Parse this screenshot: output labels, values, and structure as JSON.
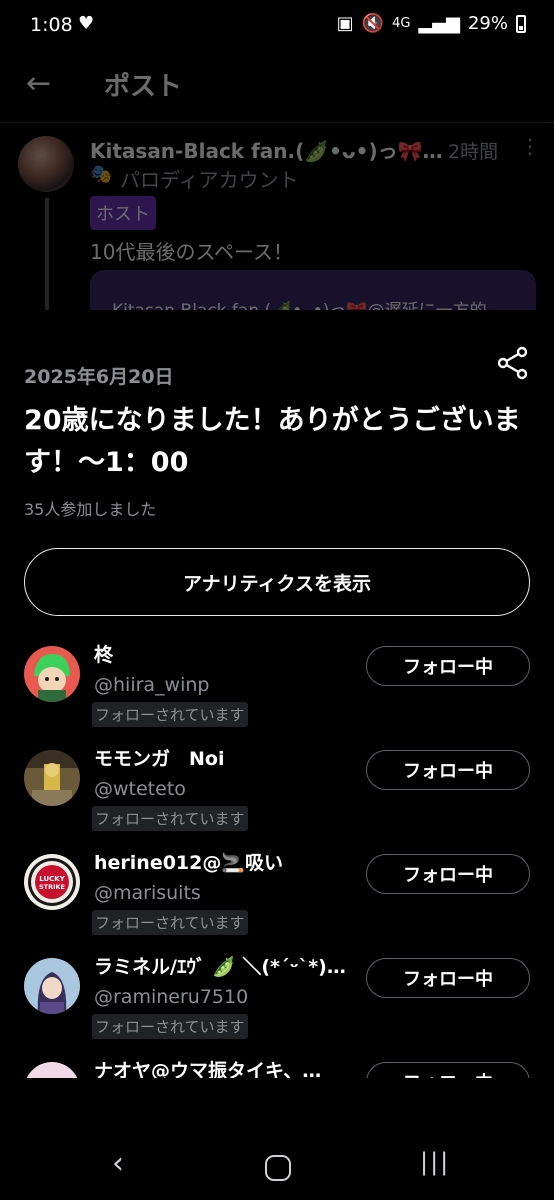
{
  "status_bar": {
    "time": "1:08",
    "heart": "♥",
    "network": "4G",
    "battery": "29%"
  },
  "header": {
    "title": "ポスト"
  },
  "post": {
    "author": "Kitasan-Black fan.(🫛•ᴗ•)っ🎀@…",
    "time": "2時間",
    "more": "⋮",
    "parody_icon": "🎭",
    "parody_label": "パロディアカウント",
    "host_badge": "ホスト",
    "text": "10代最後のスペース！",
    "quoted_text": "Kitasan-Black fan.(🫛•ᴗ•)っ🎀@遅延に一方的"
  },
  "sheet": {
    "date": "2025年6月20日",
    "title": "20歳になりました！ありがとうございます！〜1：00",
    "participants": "35人参加しました",
    "analytics_button": "アナリティクスを表示"
  },
  "users": [
    {
      "name": "柊",
      "handle": "@hiira_winp",
      "badge": "フォローされています",
      "button": "フォロー中"
    },
    {
      "name": "モモンガ　Noi",
      "handle": "@wteteto",
      "badge": "フォローされています",
      "button": "フォロー中"
    },
    {
      "name": "herine012@🚬吸い",
      "handle": "@marisuits",
      "badge": "フォローされています",
      "button": "フォロー中"
    },
    {
      "name": "ラミネル/ｴｳﾞ 🫛 ＼(*ˊᵕˋ*)／…",
      "handle": "@ramineru7510",
      "badge": "フォローされています",
      "button": "フォロー中"
    },
    {
      "name": "ナオヤ@ウマ振タイキ、…",
      "handle": "",
      "badge": "",
      "button": "フォロー中"
    }
  ],
  "colors": {
    "host_badge": "#6d34b8",
    "quoted_bg": "#3a2a6a",
    "lucky_strike_red": "#c8102e"
  },
  "icons": {
    "back": "arrow-left-icon",
    "share": "share-icon",
    "nav_back": "nav-back-icon",
    "nav_home": "nav-home-icon",
    "nav_recent": "nav-recent-icon"
  }
}
